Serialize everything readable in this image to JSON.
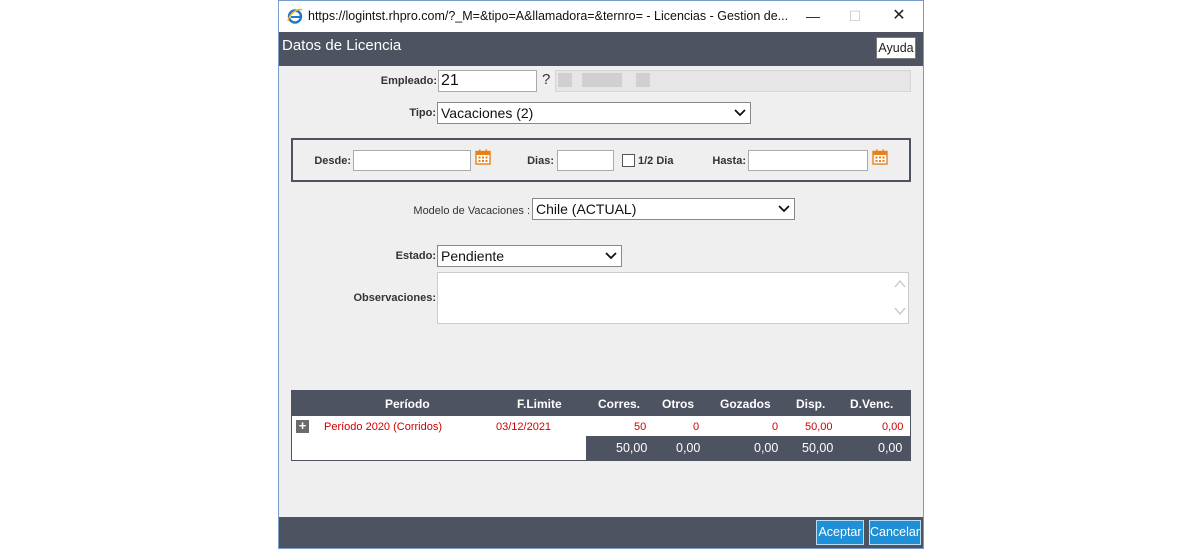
{
  "window": {
    "url_title": "https://logintst.rhpro.com/?_M=&tipo=A&llamadora=&ternro= - Licencias - Gestion de...",
    "min_glyph": "—",
    "max_glyph": "☐",
    "close_glyph": "✕"
  },
  "header": {
    "title": "Datos de Licencia",
    "help_label": "Ayuda"
  },
  "form": {
    "empleado_label": "Empleado:",
    "empleado_value": "21",
    "empleado_lookup": "?",
    "tipo_label": "Tipo:",
    "tipo_value": "Vacaciones (2)",
    "desde_label": "Desde:",
    "desde_value": "",
    "dias_label": "Dias:",
    "dias_value": "",
    "half_day_label": "1/2 Dia",
    "hasta_label": "Hasta:",
    "hasta_value": "",
    "modelo_label": "Modelo de Vacaciones :",
    "modelo_value": "Chile (ACTUAL)",
    "estado_label": "Estado:",
    "estado_value": "Pendiente",
    "observaciones_label": "Observaciones:",
    "observaciones_value": ""
  },
  "table": {
    "headers": [
      "Período",
      "F.Limite",
      "Corres.",
      "Otros",
      "Gozados",
      "Disp.",
      "D.Venc."
    ],
    "rows": [
      {
        "expand": "+",
        "periodo": "Período 2020 (Corridos)",
        "f_limite": "03/12/2021",
        "corres": "50",
        "otros": "0",
        "gozados": "0",
        "disp": "50,00",
        "d_venc": "0,00"
      }
    ],
    "totals": {
      "corres": "50,00",
      "otros": "0,00",
      "gozados": "0,00",
      "disp": "50,00",
      "d_venc": "0,00"
    }
  },
  "footer": {
    "accept_label": "Aceptar",
    "cancel_label": "Cancelar"
  },
  "colors": {
    "header_bg": "#4e5361",
    "button_bg": "#1f8fd6",
    "row_text": "#d00000",
    "calendar": "#e8801a"
  }
}
